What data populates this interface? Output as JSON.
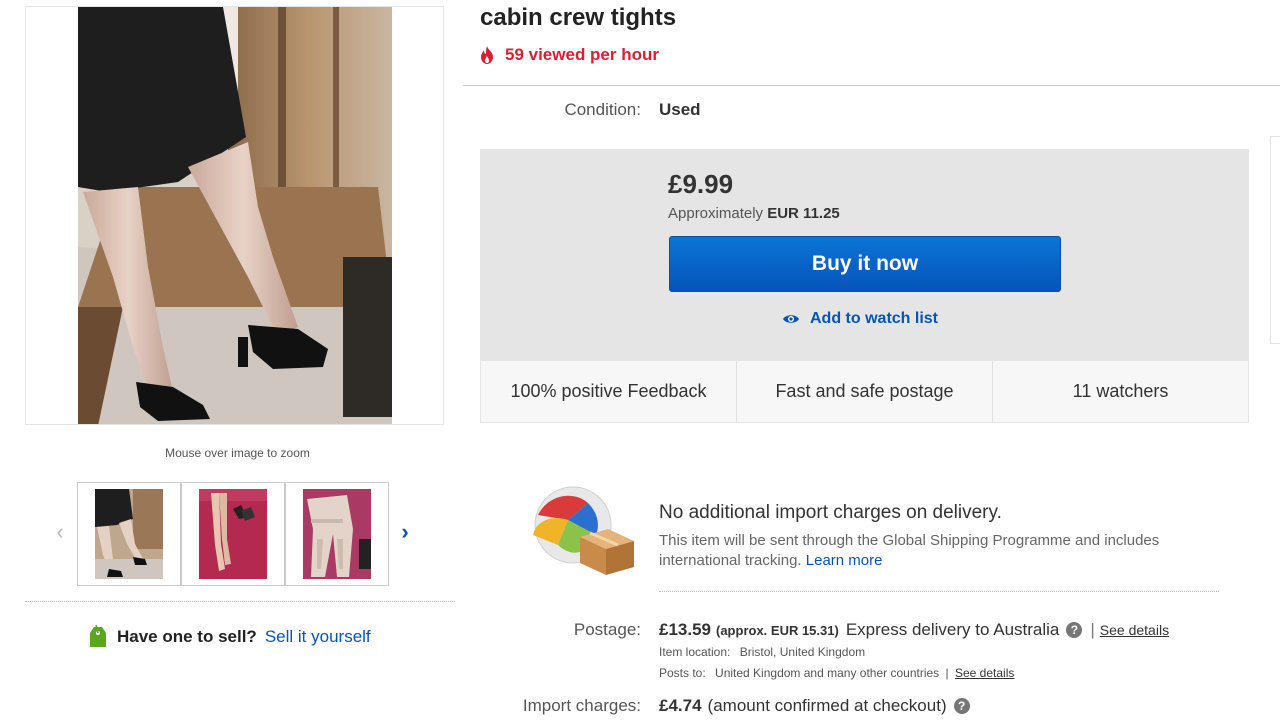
{
  "gallery": {
    "zoom_hint": "Mouse over image to zoom",
    "prev_icon": "chevron-left-icon",
    "next_icon": "chevron-right-icon",
    "thumbnail_count": 3
  },
  "sell": {
    "question": "Have one to sell?",
    "link": "Sell it yourself",
    "icon": "price-tag-icon",
    "icon_color": "#5ba71b"
  },
  "item": {
    "title": "cabin crew tights",
    "views_text": "59 viewed per hour",
    "views_icon": "fire-icon",
    "views_color": "#dd1e31",
    "condition_label": "Condition:",
    "condition_value": "Used"
  },
  "buy_box": {
    "price": "£9.99",
    "approx_prefix": "Approximately",
    "approx_value": "EUR 11.25",
    "buy_button": "Buy it now",
    "buy_button_color": "#0654ba",
    "watch_link": "Add to watch list",
    "watch_icon": "eye-icon"
  },
  "trust_bar": [
    "100% positive Feedback",
    "Fast and safe postage",
    "11 watchers"
  ],
  "shipping": {
    "gsp_icon": "global-shipping-icon",
    "gsp_heading": "No additional import charges on delivery.",
    "gsp_text": "This item will be sent through the Global Shipping Programme and includes international tracking.",
    "gsp_link": "Learn more",
    "postage_label": "Postage:",
    "postage_cost": "£13.59",
    "postage_approx": "(approx. EUR 15.31)",
    "postage_method": "Express delivery to Australia",
    "see_details": "See details",
    "location_label": "Item location:",
    "location_value": "Bristol, United Kingdom",
    "posts_to_label": "Posts to:",
    "posts_to_value": "United Kingdom and many other countries",
    "import_label": "Import charges:",
    "import_cost": "£4.74",
    "import_note": "(amount confirmed at checkout)"
  }
}
